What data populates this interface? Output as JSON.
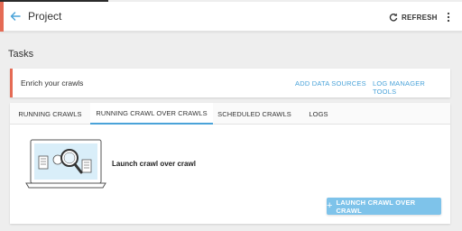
{
  "header": {
    "title": "Project",
    "refresh_label": "REFRESH",
    "back_icon": "arrow-left-icon",
    "refresh_icon": "refresh-icon",
    "more_icon": "more-vert-icon",
    "accent_color": "#e56b55"
  },
  "section": {
    "title": "Tasks"
  },
  "enrich": {
    "text": "Enrich your crawls",
    "links": [
      "ADD DATA SOURCES",
      "LOG MANAGER TOOLS"
    ],
    "link_color": "#4aa3d9"
  },
  "tabs": [
    {
      "label": "RUNNING CRAWLS",
      "active": false
    },
    {
      "label": "RUNNING CRAWL OVER CRAWLS",
      "active": true
    },
    {
      "label": "SCHEDULED CRAWLS",
      "active": false
    },
    {
      "label": "LOGS",
      "active": false
    }
  ],
  "content": {
    "heading": "Launch crawl over crawl",
    "illustration_icon": "laptop-search-icon"
  },
  "actions": {
    "launch_label": "LAUNCH CRAWL OVER CRAWL",
    "launch_icon": "plus-icon",
    "button_color": "#7ec3ea"
  }
}
